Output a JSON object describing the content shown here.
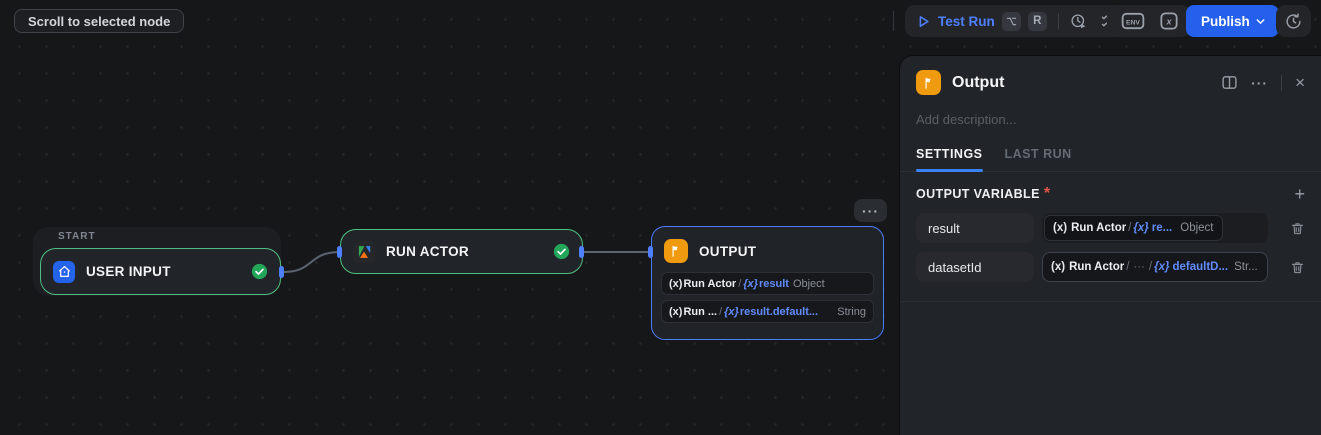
{
  "colors": {
    "accent_blue": "#4e7fff",
    "publish_blue": "#2460eb",
    "node_green": "#4fbf82",
    "node_blue": "#4d7dff",
    "output_orange": "#f09a0f",
    "check_green": "#23a55a",
    "required_red": "#e5534b",
    "tab_underline": "#3b82f6"
  },
  "toolbar": {
    "scroll_button_label": "Scroll to selected node",
    "test_run_label": "Test Run",
    "shortcut_keys": {
      "modifier_icon": "option-key",
      "key": "R"
    },
    "env_label": "ENV",
    "variables_label": "x",
    "publish_label": "Publish"
  },
  "canvas": {
    "start_group_label": "START",
    "user_input_node": {
      "title": "USER INPUT"
    },
    "run_actor_node": {
      "title": "RUN ACTOR"
    },
    "output_node": {
      "title": "OUTPUT",
      "more_label": "···",
      "rows": [
        {
          "prefix": "(x)",
          "source": "Run Actor",
          "sep": "/",
          "brace": "{x}",
          "variable": "result",
          "type": "Object"
        },
        {
          "prefix": "(x)",
          "source": "Run ...",
          "sep": "/",
          "brace": "{x}",
          "variable": "result.default...",
          "type": "String"
        }
      ]
    }
  },
  "panel": {
    "title": "Output",
    "description_placeholder": "Add description...",
    "more_label": "···",
    "close_label": "×",
    "tabs": [
      {
        "label": "SETTINGS"
      },
      {
        "label": "LAST RUN"
      }
    ],
    "section_label": "OUTPUT VARIABLE",
    "required_mark": "*",
    "add_label": "+",
    "variables": [
      {
        "name": "result",
        "prefix": "(x)",
        "source": "Run Actor",
        "sep": "/",
        "brace": "{x}",
        "variable": "re...",
        "type": "Object"
      },
      {
        "name": "datasetId",
        "prefix": "(x)",
        "source": "Run Actor",
        "sep": "/",
        "ellipsis": "···",
        "sep2": "/",
        "brace": "{x}",
        "variable": "defaultD...",
        "type": "Str..."
      }
    ]
  }
}
